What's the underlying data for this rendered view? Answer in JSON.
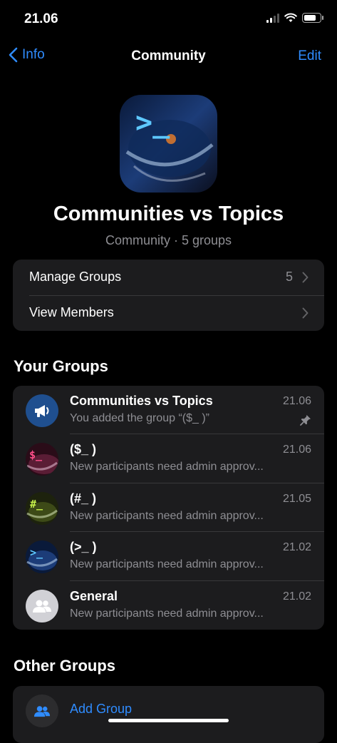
{
  "status": {
    "time": "21.06"
  },
  "nav": {
    "back_label": "Info",
    "title": "Community",
    "edit_label": "Edit"
  },
  "community": {
    "name": "Communities vs Topics",
    "subtitle": "Community · 5 groups"
  },
  "manage": {
    "manage_groups_label": "Manage Groups",
    "manage_groups_count": "5",
    "view_members_label": "View Members"
  },
  "your_groups": {
    "title": "Your Groups",
    "items": [
      {
        "name": "Communities vs Topics",
        "message": "You added the group “($_ )”",
        "time": "21.06",
        "pinned": true,
        "icon": "megaphone-icon"
      },
      {
        "name": "($_ )",
        "message": "New participants need admin approv...",
        "time": "21.06",
        "icon": "dollar-prompt-avatar"
      },
      {
        "name": "(#_ )",
        "message": "New participants need admin approv...",
        "time": "21.05",
        "icon": "hash-prompt-avatar"
      },
      {
        "name": "(>_ )",
        "message": "New participants need admin approv...",
        "time": "21.02",
        "icon": "terminal-prompt-avatar"
      },
      {
        "name": "General",
        "message": "New participants need admin approv...",
        "time": "21.02",
        "icon": "people-icon"
      }
    ]
  },
  "other_groups": {
    "title": "Other Groups",
    "add_label": "Add Group"
  },
  "colors": {
    "accent": "#2f8cff",
    "background": "#000000",
    "card": "#1c1c1e",
    "secondary_text": "#8e8e93"
  }
}
